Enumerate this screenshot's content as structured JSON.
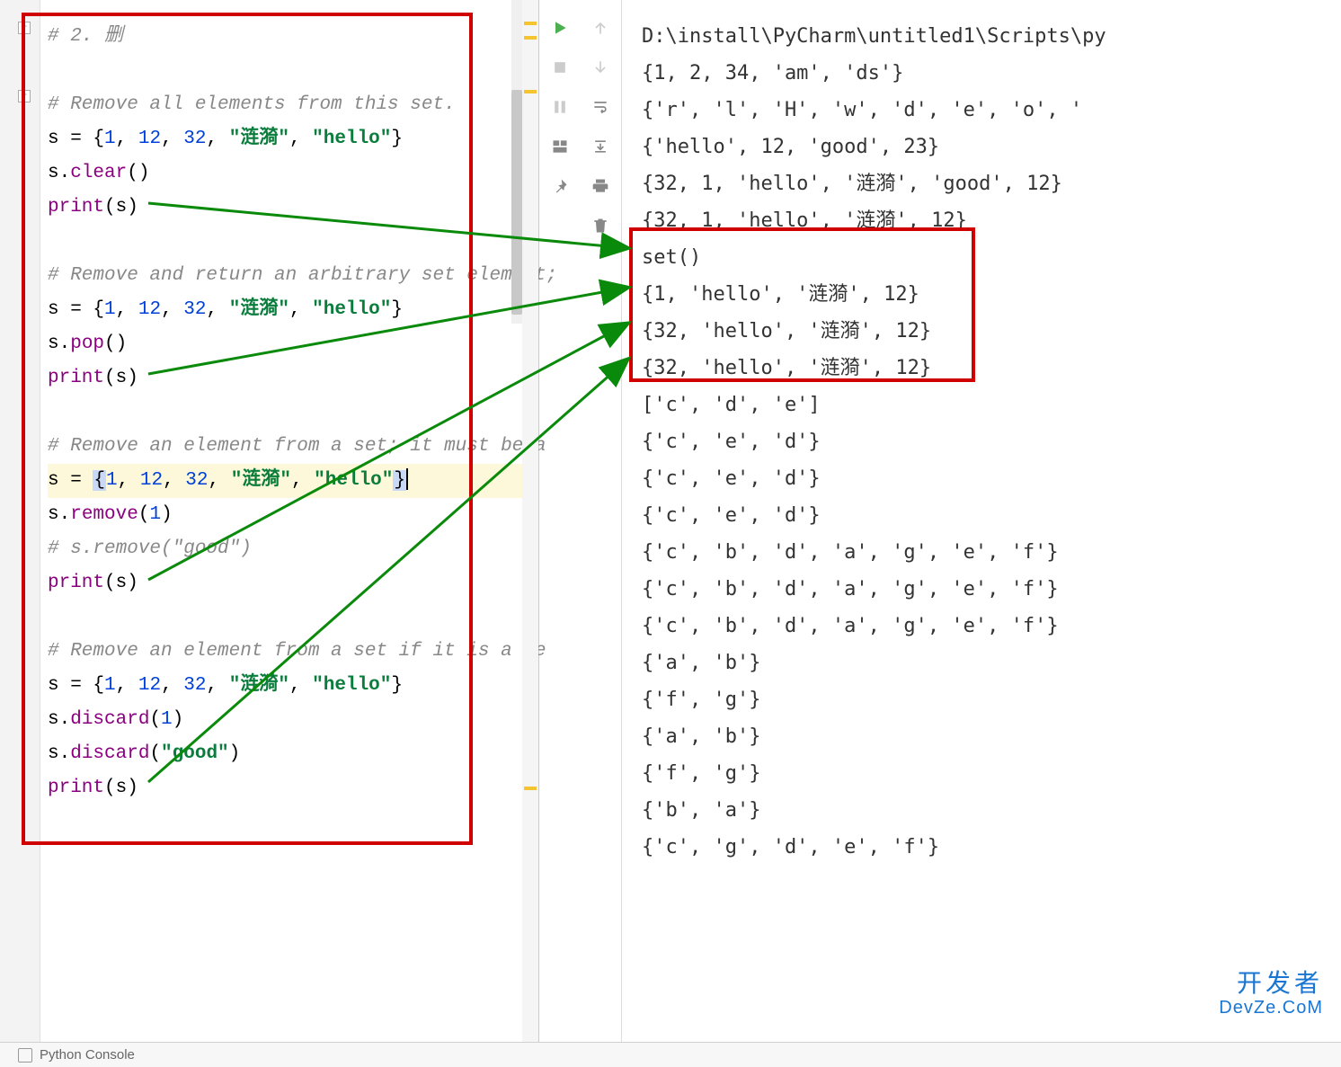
{
  "editor": {
    "comment_header": "# 2. 删",
    "c_clear": "# Remove all elements from this set.",
    "s_assign1_a": "s = {",
    "n1": "1",
    "sep": ", ",
    "n12": "12",
    "n32": "32",
    "str_li": "\"涟漪\"",
    "str_hello": "\"hello\"",
    "close": "}",
    "s_clear": "s.",
    "clear_fn": "clear",
    "paren": "()",
    "print": "print",
    "print_arg": "(s)",
    "c_pop": "# Remove and return an arbitrary set element;",
    "s_pop": "s.",
    "pop_fn": "pop",
    "c_remove": "# Remove an element from a set; it must be a",
    "s_remove": "s.",
    "remove_fn": "remove",
    "remove_arg": "(",
    "remove_one": "1",
    "remove_close": ")",
    "c_remove_good": "# s.remove(\"good\")",
    "c_discard": "# Remove an element from a set if it is a me",
    "s_discard": "s.",
    "discard_fn": "discard",
    "discard_good": "\"good\""
  },
  "output": {
    "path": "D:\\install\\PyCharm\\untitled1\\Scripts\\py",
    "l1": "{1, 2, 34, 'am', 'ds'}",
    "l2": "{'r', 'l', 'H', 'w', 'd', 'e', 'o', '",
    "l3": "{'hello', 12, 'good', 23}",
    "l4": "{32, 1, 'hello', '涟漪', 'good', 12}",
    "l5": "{32, 1, 'hello', '涟漪', 12}",
    "l6": "set()",
    "l7": "{1, 'hello', '涟漪', 12}",
    "l8": "{32, 'hello', '涟漪', 12}",
    "l9": "{32, 'hello', '涟漪', 12}",
    "l10": "['c', 'd', 'e']",
    "l11": "{'c', 'e', 'd'}",
    "l12": "{'c', 'e', 'd'}",
    "l13": "{'c', 'e', 'd'}",
    "l14": "{'c', 'b', 'd', 'a', 'g', 'e', 'f'}",
    "l15": "{'c', 'b', 'd', 'a', 'g', 'e', 'f'}",
    "l16": "{'c', 'b', 'd', 'a', 'g', 'e', 'f'}",
    "l17": "{'a', 'b'}",
    "l18": "{'f', 'g'}",
    "l19": "{'a', 'b'}",
    "l20": "{'f', 'g'}",
    "l21": "{'b', 'a'}",
    "l22": "{'c', 'g', 'd', 'e', 'f'}"
  },
  "watermark": {
    "cn": "开发者",
    "en": "DevZe.CoM"
  },
  "bottom": {
    "label": "Python Console"
  }
}
